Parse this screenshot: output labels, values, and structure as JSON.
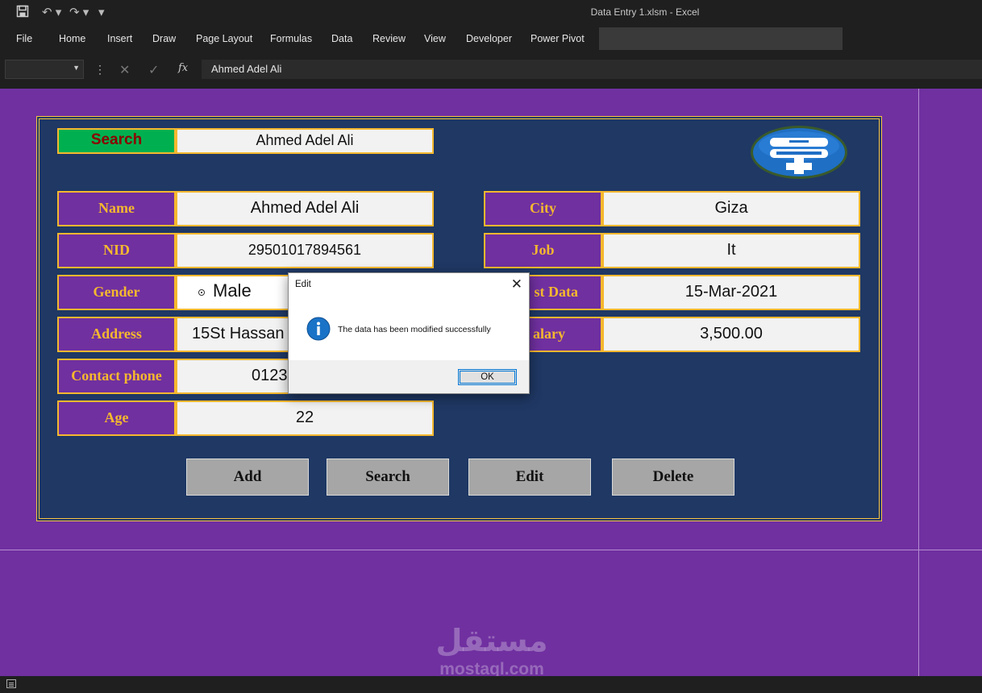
{
  "window": {
    "title": "Data Entry 1.xlsm  -  Excel"
  },
  "ribbon": {
    "tabs": [
      "File",
      "Home",
      "Insert",
      "Draw",
      "Page Layout",
      "Formulas",
      "Data",
      "Review",
      "View",
      "Developer",
      "Power Pivot"
    ]
  },
  "formula_bar": {
    "name_box": "",
    "content": "Ahmed Adel Ali"
  },
  "form": {
    "search": {
      "label": "Search",
      "value": "Ahmed Adel Ali"
    },
    "fields": {
      "name": {
        "label": "Name",
        "value": "Ahmed Adel Ali"
      },
      "nid": {
        "label": "NID",
        "value": "29501017894561"
      },
      "gender": {
        "label": "Gender",
        "value": "Male"
      },
      "address": {
        "label": "Address",
        "value": "15St Hassan"
      },
      "contact_phone": {
        "label": "Contact phone",
        "value": "0123"
      },
      "age": {
        "label": "Age",
        "value": "22"
      },
      "city": {
        "label": "City",
        "value": "Giza"
      },
      "job": {
        "label": "Job",
        "value": "It"
      },
      "first_data": {
        "label": "st Data",
        "value": "15-Mar-2021"
      },
      "salary": {
        "label": "alary",
        "value": "3,500.00"
      }
    },
    "buttons": {
      "add": "Add",
      "search": "Search",
      "edit": "Edit",
      "delete": "Delete"
    }
  },
  "dialog": {
    "title": "Edit",
    "message": "The data has been modified successfully",
    "ok": "OK"
  },
  "watermark": {
    "arabic": "مستقل",
    "latin": "mostaql.com"
  },
  "colors": {
    "sheet_bg": "#7030a0",
    "panel_bg": "#1f3864",
    "label_bg": "#7030a0",
    "label_text": "#f5b82e",
    "border_gold": "#f5b82e",
    "search_label_bg": "#00b050",
    "search_label_text": "#8b0000",
    "button_bg": "#a6a6a6",
    "info_blue": "#1a73c7"
  }
}
